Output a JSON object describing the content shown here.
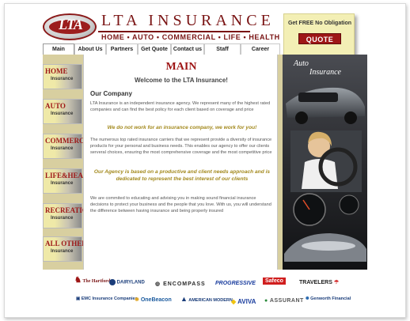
{
  "brand": {
    "logo_text": "LTA",
    "title": "LTA INSURANCE",
    "tagline": "HOME • AUTO • COMMERCIAL • LIFE • HEALTH",
    "brand_color": "#9e1616"
  },
  "quote": {
    "text": "Get FREE No Obligation",
    "button_label": "QUOTE"
  },
  "nav": {
    "items": [
      {
        "label": "Main",
        "active": true
      },
      {
        "label": "About Us",
        "active": false
      },
      {
        "label": "Partners",
        "active": false
      },
      {
        "label": "Get Quote",
        "active": false
      },
      {
        "label": "Contact us",
        "active": false
      },
      {
        "label": "Staff",
        "active": false
      },
      {
        "label": "Career",
        "active": false
      }
    ]
  },
  "sidebar": {
    "items": [
      {
        "title": "HOME",
        "sub": "Insurance"
      },
      {
        "title": "AUTO",
        "sub": "Insurance"
      },
      {
        "title": "COMMERCIAL",
        "sub": "Insurance"
      },
      {
        "title": "LIFE&HEALTH",
        "sub": "Insurance"
      },
      {
        "title": "RECREATION",
        "sub": "Insurance"
      },
      {
        "title": "ALL OTHER",
        "sub": "Insurance"
      }
    ]
  },
  "main": {
    "heading": "MAIN",
    "welcome": "Welcome to the LTA Insurance!",
    "section_title": "Our Company",
    "para1": "LTA Insurance is an independent insurance agency. We represent many of the highest rated companies and can find the best policy for each client based on coverage and price",
    "highlight1": "We do not work for an insurance company, we work for you!",
    "para2": "The numerous top rated insurance carriers that we represent provide a diversity of insurance products for your personal and business needs. This enables our agency to offer our clients serveral choices, ensuring the most comprehensive coverage and the most competitive price",
    "highlight2": "Our Agency is based on a productive and client needs approach and is dedicated to represent the best interest of our clients",
    "para3": "We are commited to educating and advising you in making sound financial insurance decisions to protect your business and the people that you love. With us, you will understand the difference between having insurance and being properly insured"
  },
  "right_panel": {
    "title_line1": "Auto",
    "title_line2": "Insurance"
  },
  "partners": {
    "row1": [
      {
        "name": "The Hartford",
        "icon": "stag-icon"
      },
      {
        "name": "DAIRYLAND",
        "icon": "dairyland-icon"
      },
      {
        "name": "ENCOMPASS",
        "icon": "encompass-icon"
      },
      {
        "name": "PROGRESSIVE",
        "icon": "progressive-icon"
      },
      {
        "name": "Safeco",
        "icon": "safeco-icon"
      },
      {
        "name": "TRAVELERS",
        "icon": "umbrella-icon"
      }
    ],
    "row2": [
      {
        "name": "EMC Insurance Companies",
        "icon": "emc-icon"
      },
      {
        "name": "OneBeacon",
        "icon": "onebeacon-icon"
      },
      {
        "name": "AMERICAN MODERN",
        "icon": "american-modern-icon"
      },
      {
        "name": "AVIVA",
        "icon": "aviva-icon"
      },
      {
        "name": "ASSURANT",
        "icon": "assurant-icon"
      },
      {
        "name": "Genworth Financial",
        "icon": "genworth-icon"
      }
    ]
  }
}
